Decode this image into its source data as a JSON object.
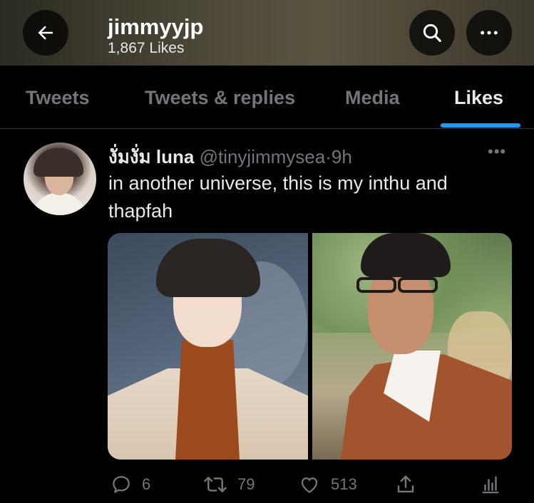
{
  "header": {
    "title": "jimmyyjp",
    "subtitle": "1,867 Likes"
  },
  "tabs": [
    {
      "label": "Tweets"
    },
    {
      "label": "Tweets & replies"
    },
    {
      "label": "Media"
    },
    {
      "label": "Likes"
    }
  ],
  "active_tab": "Likes",
  "tweet": {
    "author_name": "งั่มงั่ม luna",
    "handle": "@tinyjimmysea",
    "separator": "·",
    "time": "9h",
    "text": "in another universe, this is my inthu and thapfah",
    "more": "•••",
    "replies": "6",
    "retweets": "79",
    "likes": "513"
  },
  "icons": {
    "back": "arrow-left-icon",
    "search": "search-icon",
    "more": "more-horizontal-icon",
    "reply": "reply-icon",
    "retweet": "retweet-icon",
    "like": "heart-icon",
    "share": "share-icon",
    "analytics": "analytics-icon"
  },
  "colors": {
    "accent": "#1d9bf0",
    "background": "#000000",
    "text": "#e7e9ea",
    "muted": "#71767b"
  }
}
